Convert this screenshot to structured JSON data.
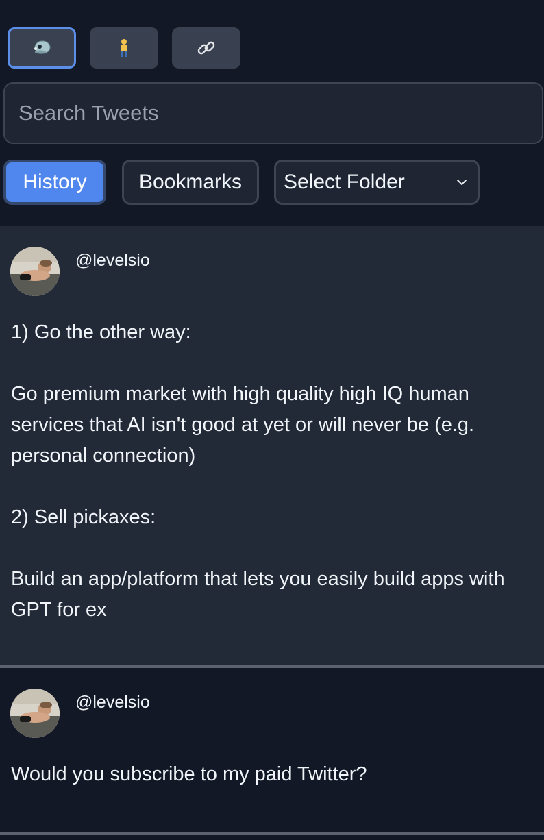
{
  "toolbar": {
    "buttons": [
      {
        "icon": "alien-icon",
        "active": true
      },
      {
        "icon": "person-icon",
        "active": false
      },
      {
        "icon": "link-icon",
        "active": false
      }
    ]
  },
  "search": {
    "placeholder": "Search Tweets",
    "value": ""
  },
  "filters": {
    "history_label": "History",
    "bookmarks_label": "Bookmarks",
    "folder_select": "Select Folder",
    "active": "History",
    "accent_color": "#4f87ef"
  },
  "tweets": [
    {
      "handle": "@levelsio",
      "paragraphs": [
        "1) Go the other way:",
        "Go premium market with high quality high IQ human services that AI isn't good at yet or will never be (e.g. personal connection)",
        "2) Sell pickaxes:",
        "Build an app/platform that lets you easily build apps with GPT for ex"
      ]
    },
    {
      "handle": "@levelsio",
      "paragraphs": [
        "Would you subscribe to my paid Twitter?"
      ]
    }
  ]
}
